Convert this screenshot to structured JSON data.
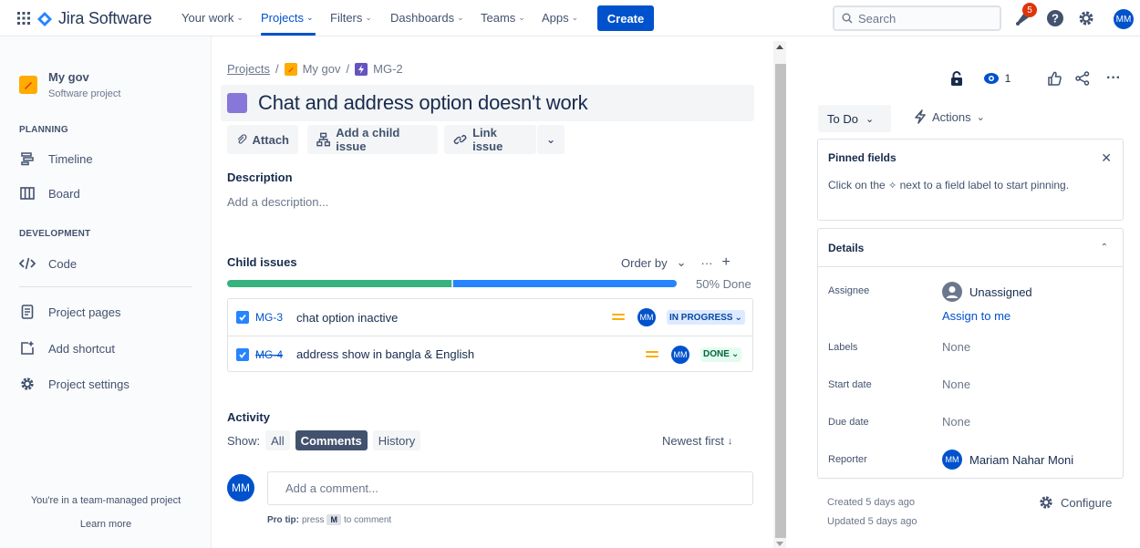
{
  "topnav": {
    "logo_text": "Jira Software",
    "items": [
      {
        "label": "Your work"
      },
      {
        "label": "Projects"
      },
      {
        "label": "Filters"
      },
      {
        "label": "Dashboards"
      },
      {
        "label": "Teams"
      },
      {
        "label": "Apps"
      }
    ],
    "create_label": "Create",
    "search_placeholder": "Search",
    "notification_count": "5",
    "user_initials": "MM"
  },
  "sidebar": {
    "project_name": "My gov",
    "project_type": "Software project",
    "planning_label": "PLANNING",
    "development_label": "DEVELOPMENT",
    "items": [
      {
        "label": "Timeline"
      },
      {
        "label": "Board"
      },
      {
        "label": "Code"
      },
      {
        "label": "Project pages"
      },
      {
        "label": "Add shortcut"
      },
      {
        "label": "Project settings"
      }
    ],
    "team_managed_text": "You're in a team-managed project",
    "learn_more": "Learn more"
  },
  "issue": {
    "breadcrumb": [
      "Projects",
      "My gov",
      "MG-2"
    ],
    "title": "Chat and address option doesn't work",
    "buttons": {
      "attach": "Attach",
      "add_child": "Add a child issue",
      "link": "Link issue"
    },
    "description_label": "Description",
    "description_placeholder": "Add a description...",
    "child_issues_label": "Child issues",
    "order_by": "Order by",
    "progress_done_fraction": 0.5,
    "progress_label": "50% Done",
    "children": [
      {
        "key": "MG-3",
        "summary": "chat option inactive",
        "status": "IN PROGRESS",
        "assignee": "MM"
      },
      {
        "key": "MG-4",
        "summary": "address show in bangla & English",
        "status": "DONE",
        "assignee": "MM"
      }
    ],
    "activity_label": "Activity",
    "show_label": "Show:",
    "activity_filters": [
      "All",
      "Comments",
      "History"
    ],
    "sort_label": "Newest first",
    "comment_placeholder": "Add a comment...",
    "comment_avatar": "MM",
    "protip_bold": "Pro tip:",
    "protip_pre": "press",
    "protip_key": "M",
    "protip_post": "to comment"
  },
  "right": {
    "watch_count": "1",
    "status_label": "To Do",
    "actions_label": "Actions",
    "pinned_title": "Pinned fields",
    "pinned_text_pre": "Click on the",
    "pinned_text_post": "next to a field label to start pinning.",
    "details_title": "Details",
    "fields": {
      "assignee_label": "Assignee",
      "assignee_value": "Unassigned",
      "assign_to_me": "Assign to me",
      "labels_label": "Labels",
      "labels_value": "None",
      "start_label": "Start date",
      "start_value": "None",
      "due_label": "Due date",
      "due_value": "None",
      "reporter_label": "Reporter",
      "reporter_value": "Mariam Nahar Moni",
      "reporter_initials": "MM"
    },
    "created": "Created 5 days ago",
    "updated": "Updated 5 days ago",
    "configure_label": "Configure"
  }
}
